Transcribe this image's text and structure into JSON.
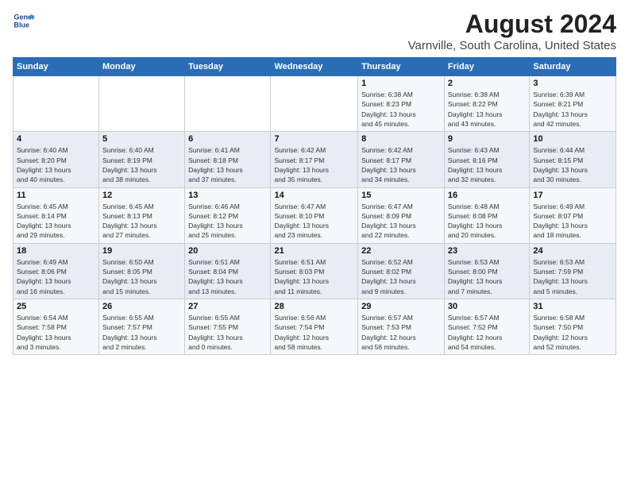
{
  "header": {
    "logo_line1": "General",
    "logo_line2": "Blue",
    "title": "August 2024",
    "subtitle": "Varnville, South Carolina, United States"
  },
  "weekdays": [
    "Sunday",
    "Monday",
    "Tuesday",
    "Wednesday",
    "Thursday",
    "Friday",
    "Saturday"
  ],
  "weeks": [
    [
      {
        "day": "",
        "info": ""
      },
      {
        "day": "",
        "info": ""
      },
      {
        "day": "",
        "info": ""
      },
      {
        "day": "",
        "info": ""
      },
      {
        "day": "1",
        "info": "Sunrise: 6:38 AM\nSunset: 8:23 PM\nDaylight: 13 hours\nand 45 minutes."
      },
      {
        "day": "2",
        "info": "Sunrise: 6:38 AM\nSunset: 8:22 PM\nDaylight: 13 hours\nand 43 minutes."
      },
      {
        "day": "3",
        "info": "Sunrise: 6:39 AM\nSunset: 8:21 PM\nDaylight: 13 hours\nand 42 minutes."
      }
    ],
    [
      {
        "day": "4",
        "info": "Sunrise: 6:40 AM\nSunset: 8:20 PM\nDaylight: 13 hours\nand 40 minutes."
      },
      {
        "day": "5",
        "info": "Sunrise: 6:40 AM\nSunset: 8:19 PM\nDaylight: 13 hours\nand 38 minutes."
      },
      {
        "day": "6",
        "info": "Sunrise: 6:41 AM\nSunset: 8:18 PM\nDaylight: 13 hours\nand 37 minutes."
      },
      {
        "day": "7",
        "info": "Sunrise: 6:42 AM\nSunset: 8:17 PM\nDaylight: 13 hours\nand 35 minutes."
      },
      {
        "day": "8",
        "info": "Sunrise: 6:42 AM\nSunset: 8:17 PM\nDaylight: 13 hours\nand 34 minutes."
      },
      {
        "day": "9",
        "info": "Sunrise: 6:43 AM\nSunset: 8:16 PM\nDaylight: 13 hours\nand 32 minutes."
      },
      {
        "day": "10",
        "info": "Sunrise: 6:44 AM\nSunset: 8:15 PM\nDaylight: 13 hours\nand 30 minutes."
      }
    ],
    [
      {
        "day": "11",
        "info": "Sunrise: 6:45 AM\nSunset: 8:14 PM\nDaylight: 13 hours\nand 29 minutes."
      },
      {
        "day": "12",
        "info": "Sunrise: 6:45 AM\nSunset: 8:13 PM\nDaylight: 13 hours\nand 27 minutes."
      },
      {
        "day": "13",
        "info": "Sunrise: 6:46 AM\nSunset: 8:12 PM\nDaylight: 13 hours\nand 25 minutes."
      },
      {
        "day": "14",
        "info": "Sunrise: 6:47 AM\nSunset: 8:10 PM\nDaylight: 13 hours\nand 23 minutes."
      },
      {
        "day": "15",
        "info": "Sunrise: 6:47 AM\nSunset: 8:09 PM\nDaylight: 13 hours\nand 22 minutes."
      },
      {
        "day": "16",
        "info": "Sunrise: 6:48 AM\nSunset: 8:08 PM\nDaylight: 13 hours\nand 20 minutes."
      },
      {
        "day": "17",
        "info": "Sunrise: 6:49 AM\nSunset: 8:07 PM\nDaylight: 13 hours\nand 18 minutes."
      }
    ],
    [
      {
        "day": "18",
        "info": "Sunrise: 6:49 AM\nSunset: 8:06 PM\nDaylight: 13 hours\nand 16 minutes."
      },
      {
        "day": "19",
        "info": "Sunrise: 6:50 AM\nSunset: 8:05 PM\nDaylight: 13 hours\nand 15 minutes."
      },
      {
        "day": "20",
        "info": "Sunrise: 6:51 AM\nSunset: 8:04 PM\nDaylight: 13 hours\nand 13 minutes."
      },
      {
        "day": "21",
        "info": "Sunrise: 6:51 AM\nSunset: 8:03 PM\nDaylight: 13 hours\nand 11 minutes."
      },
      {
        "day": "22",
        "info": "Sunrise: 6:52 AM\nSunset: 8:02 PM\nDaylight: 13 hours\nand 9 minutes."
      },
      {
        "day": "23",
        "info": "Sunrise: 6:53 AM\nSunset: 8:00 PM\nDaylight: 13 hours\nand 7 minutes."
      },
      {
        "day": "24",
        "info": "Sunrise: 6:53 AM\nSunset: 7:59 PM\nDaylight: 13 hours\nand 5 minutes."
      }
    ],
    [
      {
        "day": "25",
        "info": "Sunrise: 6:54 AM\nSunset: 7:58 PM\nDaylight: 13 hours\nand 3 minutes."
      },
      {
        "day": "26",
        "info": "Sunrise: 6:55 AM\nSunset: 7:57 PM\nDaylight: 13 hours\nand 2 minutes."
      },
      {
        "day": "27",
        "info": "Sunrise: 6:55 AM\nSunset: 7:55 PM\nDaylight: 13 hours\nand 0 minutes."
      },
      {
        "day": "28",
        "info": "Sunrise: 6:56 AM\nSunset: 7:54 PM\nDaylight: 12 hours\nand 58 minutes."
      },
      {
        "day": "29",
        "info": "Sunrise: 6:57 AM\nSunset: 7:53 PM\nDaylight: 12 hours\nand 56 minutes."
      },
      {
        "day": "30",
        "info": "Sunrise: 6:57 AM\nSunset: 7:52 PM\nDaylight: 12 hours\nand 54 minutes."
      },
      {
        "day": "31",
        "info": "Sunrise: 6:58 AM\nSunset: 7:50 PM\nDaylight: 12 hours\nand 52 minutes."
      }
    ]
  ]
}
